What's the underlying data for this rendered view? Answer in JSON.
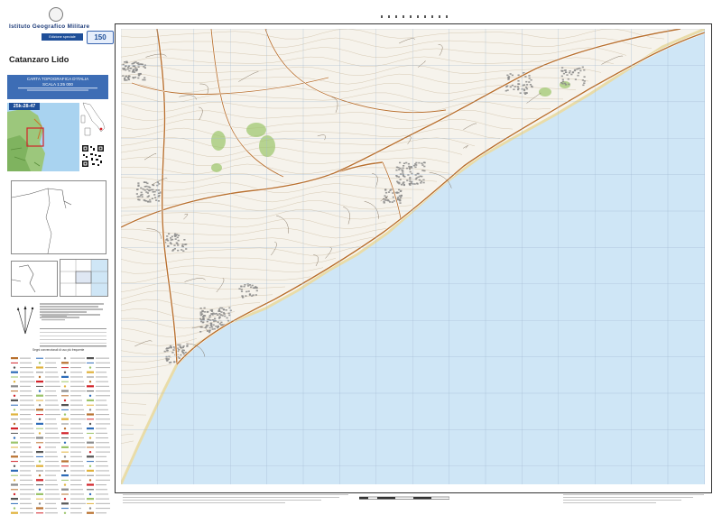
{
  "publisher": {
    "name": "Istituto Geografico Militare",
    "edition_label": "Edizione speciale",
    "anniversary_badge": "150",
    "emblem_icon": "republic-emblem-icon"
  },
  "sheet": {
    "name": "Catanzaro Lido",
    "series": "CARTA TOPOGRAFICA D'ITALIA",
    "scale": "SCALA 1:25 000",
    "code": "25k-28-47"
  },
  "map": {
    "sea_color": "#cfe6f6",
    "land_color": "#f6f3ec",
    "road_color": "#b8702e",
    "contour_color": "#c7b596",
    "vegetation_color": "#9bc46a",
    "grid_color": "#9fb7cf"
  },
  "legend": {
    "heading": "Segni convenzionali di uso più frequente"
  }
}
